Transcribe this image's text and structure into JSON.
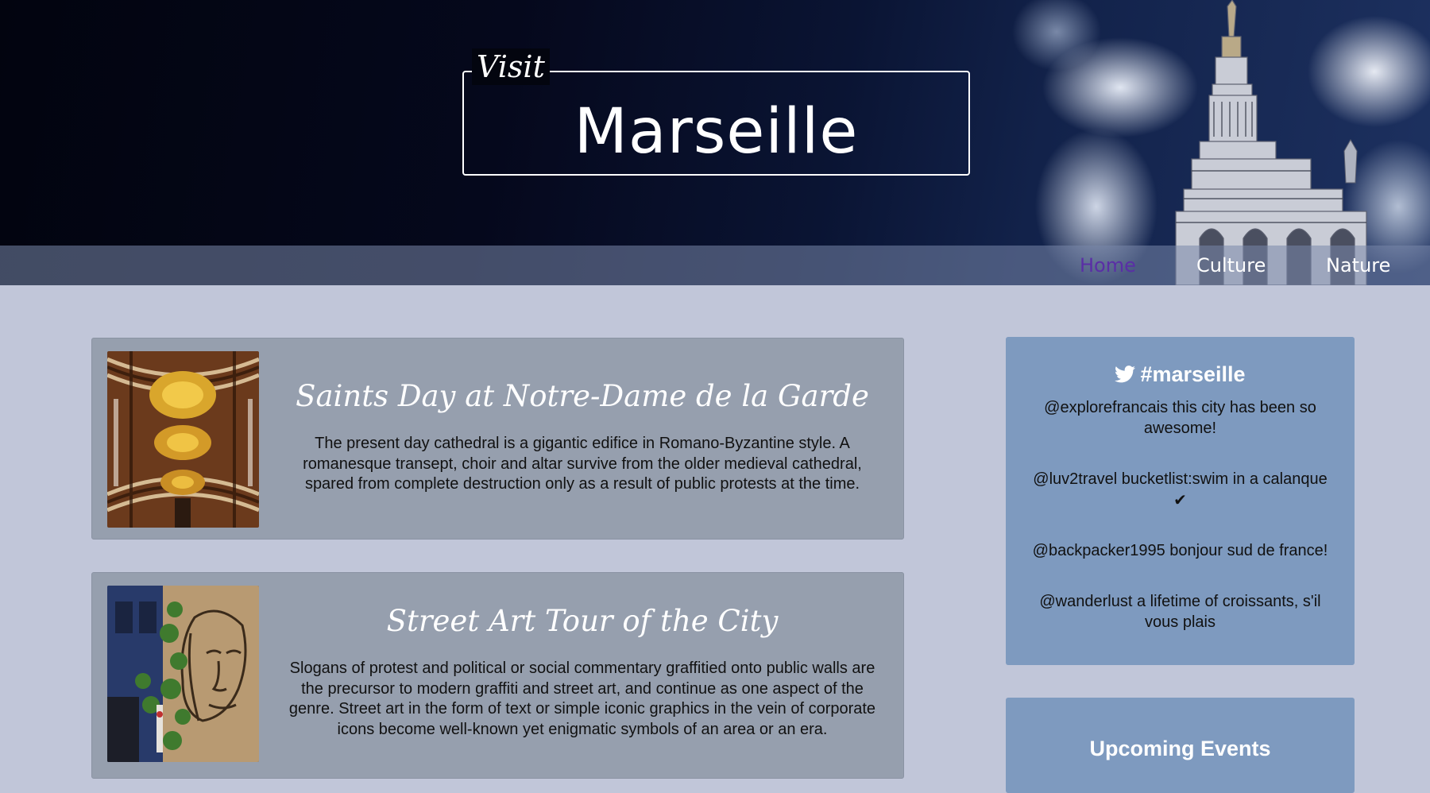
{
  "hero": {
    "pre_title": "Visit",
    "title": "Marseille"
  },
  "nav": {
    "items": [
      {
        "label": "Home",
        "active": true
      },
      {
        "label": "Culture",
        "active": false
      },
      {
        "label": "Nature",
        "active": false
      }
    ]
  },
  "articles": [
    {
      "title": "Saints Day at Notre-Dame de la Garde",
      "body": "The present day cathedral is a gigantic edifice in Romano-Byzantine style. A romanesque transept, choir and altar survive from the older medieval cathedral, spared from complete destruction only as a result of public protests at the time."
    },
    {
      "title": "Street Art Tour of the City",
      "body": "Slogans of protest and political or social commentary graffitied onto public walls are the precursor to modern graffiti and street art, and continue as one aspect of the genre. Street art in the form of text or simple iconic graphics in the vein of corporate icons become well-known yet enigmatic symbols of an area or an era."
    }
  ],
  "twitter": {
    "hashtag": "#marseille",
    "icon": "twitter-bird-icon",
    "tweets": [
      {
        "text": "@explorefrancais this city has been so awesome!"
      },
      {
        "text": "@luv2travel bucketlist:swim in a calanque",
        "suffix": "✔"
      },
      {
        "text": "@backpacker1995 bonjour sud de france!"
      },
      {
        "text": "@wanderlust a lifetime of croissants, s'il vous plais"
      }
    ]
  },
  "events": {
    "title": "Upcoming Events"
  },
  "colors": {
    "page_background": "#c1c6d9",
    "article_card": "#969fae",
    "widget": "#7e9abf",
    "nav_active": "#5a2ea6"
  }
}
